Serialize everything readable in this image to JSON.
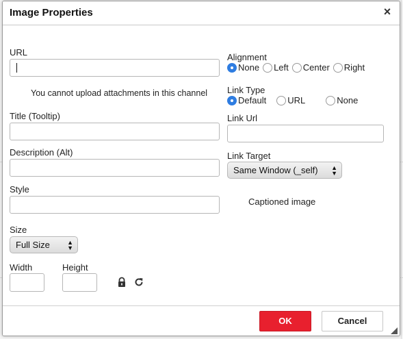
{
  "dialog": {
    "title": "Image Properties",
    "close_icon": "×"
  },
  "left": {
    "url_label": "URL",
    "url_value": "",
    "upload_note": "You cannot upload attachments in this channel",
    "title_label": "Title (Tooltip)",
    "title_value": "",
    "description_label": "Description (Alt)",
    "description_value": "",
    "style_label": "Style",
    "style_value": "",
    "size_label": "Size",
    "size_selected": "Full Size",
    "width_label": "Width",
    "width_value": "",
    "height_label": "Height",
    "height_value": "",
    "lock_icon": "lock-icon",
    "reset_icon": "reset-icon"
  },
  "right": {
    "alignment_label": "Alignment",
    "alignment_options": [
      {
        "label": "None",
        "checked": true
      },
      {
        "label": "Left",
        "checked": false
      },
      {
        "label": "Center",
        "checked": false
      },
      {
        "label": "Right",
        "checked": false
      }
    ],
    "link_type_label": "Link Type",
    "link_type_options": [
      {
        "label": "Default",
        "checked": true
      },
      {
        "label": "URL",
        "checked": false
      },
      {
        "label": "None",
        "checked": false
      }
    ],
    "link_url_label": "Link Url",
    "link_url_value": "",
    "link_target_label": "Link Target",
    "link_target_selected": "Same Window (_self)",
    "captioned_label": "Captioned image"
  },
  "footer": {
    "ok_label": "OK",
    "cancel_label": "Cancel"
  },
  "colors": {
    "accent": "#2f7de1",
    "ok_button": "#e8202e"
  }
}
